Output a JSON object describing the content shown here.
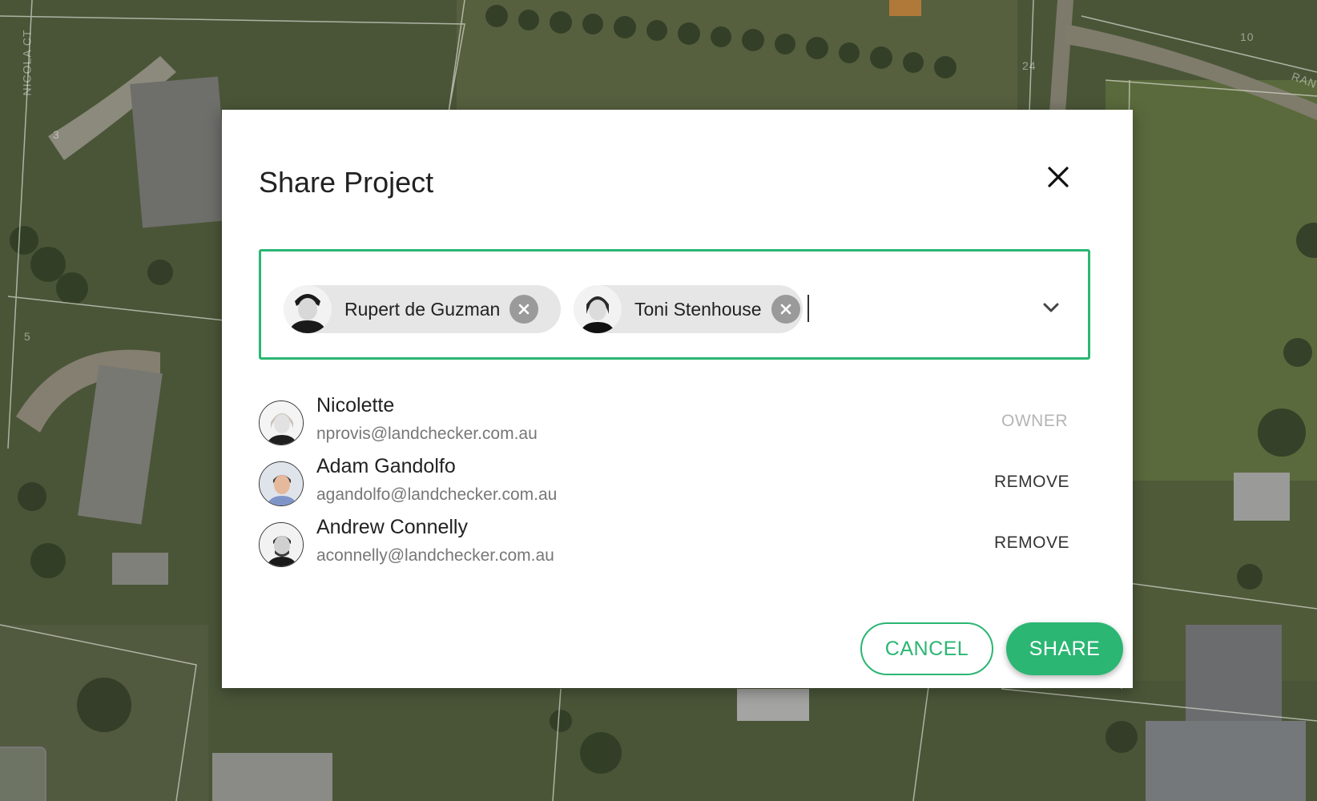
{
  "map": {
    "road_labels": [
      "NICOLA CT",
      "RAN",
      "10"
    ],
    "lot_numbers": [
      "3",
      "5",
      "24"
    ]
  },
  "dialog": {
    "title": "Share Project",
    "close_icon": "close-icon"
  },
  "picker": {
    "selected": [
      {
        "name": "Rupert de Guzman",
        "avatar": "avatar-photo",
        "remove_icon": "clear-circle-icon"
      },
      {
        "name": "Toni Stenhouse",
        "avatar": "avatar-photo",
        "remove_icon": "clear-circle-icon"
      }
    ],
    "input_value": "",
    "dropdown_icon": "chevron-down-icon"
  },
  "members": [
    {
      "name": "Nicolette",
      "email": "nprovis@landchecker.com.au",
      "action": "OWNER"
    },
    {
      "name": "Adam Gandolfo",
      "email": "agandolfo@landchecker.com.au",
      "action": "REMOVE"
    },
    {
      "name": "Andrew Connelly",
      "email": "aconnelly@landchecker.com.au",
      "action": "REMOVE"
    }
  ],
  "buttons": {
    "cancel": "CANCEL",
    "share": "SHARE"
  },
  "colors": {
    "accent": "#2bb673",
    "owner_text": "#b5b5b5",
    "overlay": "#3f4a33"
  }
}
